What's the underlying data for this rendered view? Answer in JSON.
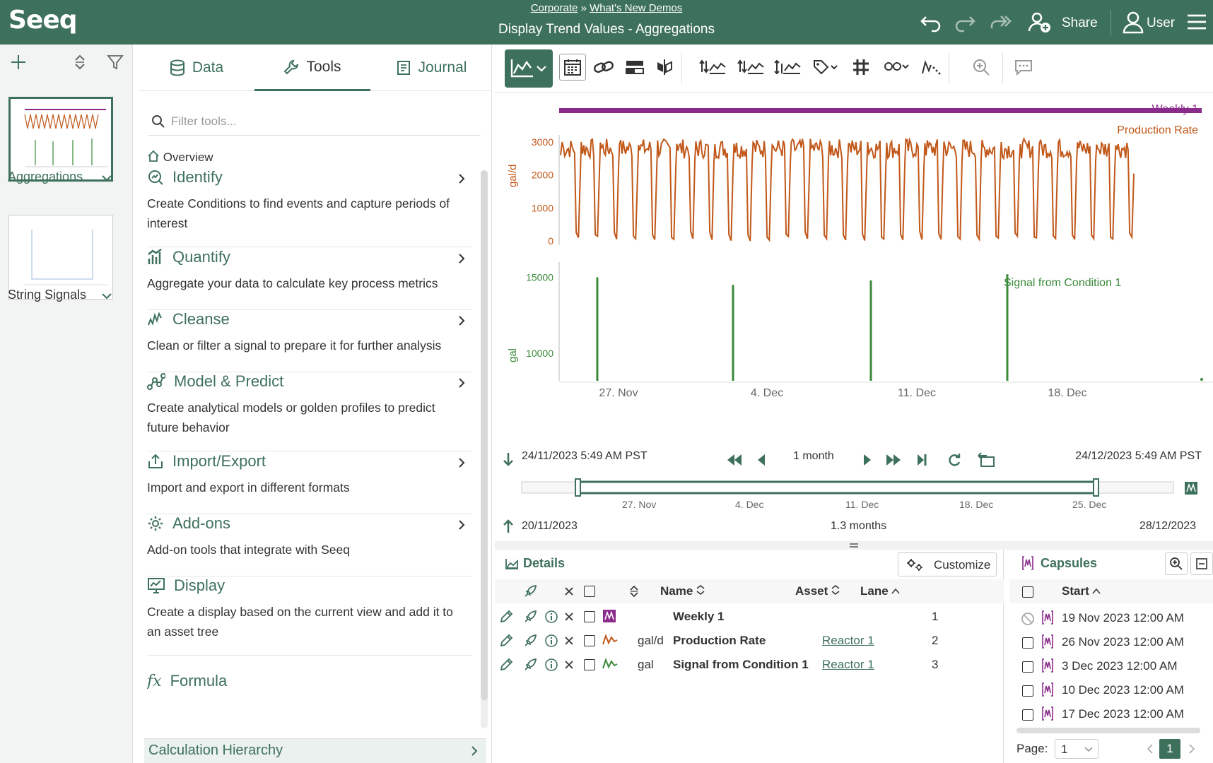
{
  "header": {
    "logo": "Seeq",
    "breadcrumb": [
      "Corporate",
      "What's New Demos"
    ],
    "breadcrumb_sep": "»",
    "title": "Display Trend Values - Aggregations",
    "share_label": "Share",
    "user_label": "User"
  },
  "worksheets": [
    {
      "label": "Aggregations",
      "active": true
    },
    {
      "label": "String Signals",
      "active": false
    }
  ],
  "tools_panel": {
    "tabs": [
      {
        "label": "Data",
        "icon": "database-icon"
      },
      {
        "label": "Tools",
        "icon": "wrench-icon",
        "active": true
      },
      {
        "label": "Journal",
        "icon": "journal-icon"
      }
    ],
    "filter_placeholder": "Filter tools...",
    "overview_label": "Overview",
    "items": [
      {
        "title": "Identify",
        "icon": "identify-icon",
        "desc": "Create Conditions to find events and capture periods of interest"
      },
      {
        "title": "Quantify",
        "icon": "quantify-icon",
        "desc": "Aggregate your data to calculate key process metrics"
      },
      {
        "title": "Cleanse",
        "icon": "cleanse-icon",
        "desc": "Clean or filter a signal to prepare it for further analysis"
      },
      {
        "title": "Model & Predict",
        "icon": "model-icon",
        "desc": "Create analytical models or golden profiles to predict future behavior"
      },
      {
        "title": "Import/Export",
        "icon": "export-icon",
        "desc": "Import and export in different formats"
      },
      {
        "title": "Add-ons",
        "icon": "gear-icon",
        "desc": "Add-on tools that integrate with Seeq"
      },
      {
        "title": "Display",
        "icon": "display-icon",
        "desc": "Create a display based on the current view and add it to an asset tree"
      },
      {
        "title": "Formula",
        "icon": "formula-icon",
        "desc": ""
      }
    ],
    "calc_hierarchy": "Calculation Hierarchy"
  },
  "trend": {
    "lane1_legend_top": "Weekly 1",
    "lane1_legend": "Production Rate",
    "lane1_unit": "gal/d",
    "lane1_ticks": [
      "3000",
      "2000",
      "1000",
      "0"
    ],
    "lane2_legend": "Signal from Condition 1",
    "lane2_unit": "gal",
    "lane2_ticks": [
      "15000",
      "10000"
    ],
    "x_ticks": [
      "27. Nov",
      "4. Dec",
      "11. Dec",
      "18. Dec"
    ],
    "start": "24/11/2023 5:49 AM  PST",
    "end": "24/12/2023 5:49 AM  PST",
    "duration": "1 month",
    "range_start": "20/11/2023",
    "range_end": "28/12/2023",
    "range_duration": "1.3 months",
    "range_ticks": [
      "27. Nov",
      "4. Dec",
      "11. Dec",
      "18. Dec",
      "25. Dec"
    ],
    "colors": {
      "weekly": "#8a2b8c",
      "production": "#c1581a",
      "signal": "#3a8a3a"
    }
  },
  "chart_data": {
    "type": "line",
    "x_range": [
      "24/11/2023 5:49 AM",
      "24/12/2023 5:49 AM"
    ],
    "series": [
      {
        "name": "Production Rate",
        "unit": "gal/d",
        "ylim": [
          0,
          3000
        ],
        "pattern": "daily cycles between ~0 and ~3000"
      },
      {
        "name": "Signal from Condition 1",
        "unit": "gal",
        "x": [
          "26 Nov 2023",
          "3 Dec 2023",
          "10 Dec 2023",
          "17 Dec 2023"
        ],
        "values": [
          15000,
          14500,
          14800,
          15200
        ],
        "ylim": [
          8000,
          16000
        ]
      }
    ]
  },
  "details": {
    "title": "Details",
    "customize": "Customize",
    "columns": {
      "name": "Name",
      "asset": "Asset",
      "lane": "Lane"
    },
    "rows": [
      {
        "unit": "",
        "name": "Weekly 1",
        "asset": "",
        "lane": "1",
        "type": "condition"
      },
      {
        "unit": "gal/d",
        "name": "Production Rate",
        "asset": "Reactor 1",
        "lane": "2",
        "type": "signal"
      },
      {
        "unit": "gal",
        "name": "Signal from Condition 1",
        "asset": "Reactor 1",
        "lane": "3",
        "type": "signal"
      }
    ]
  },
  "capsules": {
    "title": "Capsules",
    "column_start": "Start",
    "rows": [
      {
        "start": "19 Nov 2023 12:00 AM",
        "disabled": true
      },
      {
        "start": "26 Nov 2023 12:00 AM"
      },
      {
        "start": "3 Dec 2023 12:00 AM"
      },
      {
        "start": "10 Dec 2023 12:00 AM"
      },
      {
        "start": "17 Dec 2023 12:00 AM"
      }
    ],
    "page_label": "Page:",
    "page_value": "1",
    "current_page": "1"
  }
}
